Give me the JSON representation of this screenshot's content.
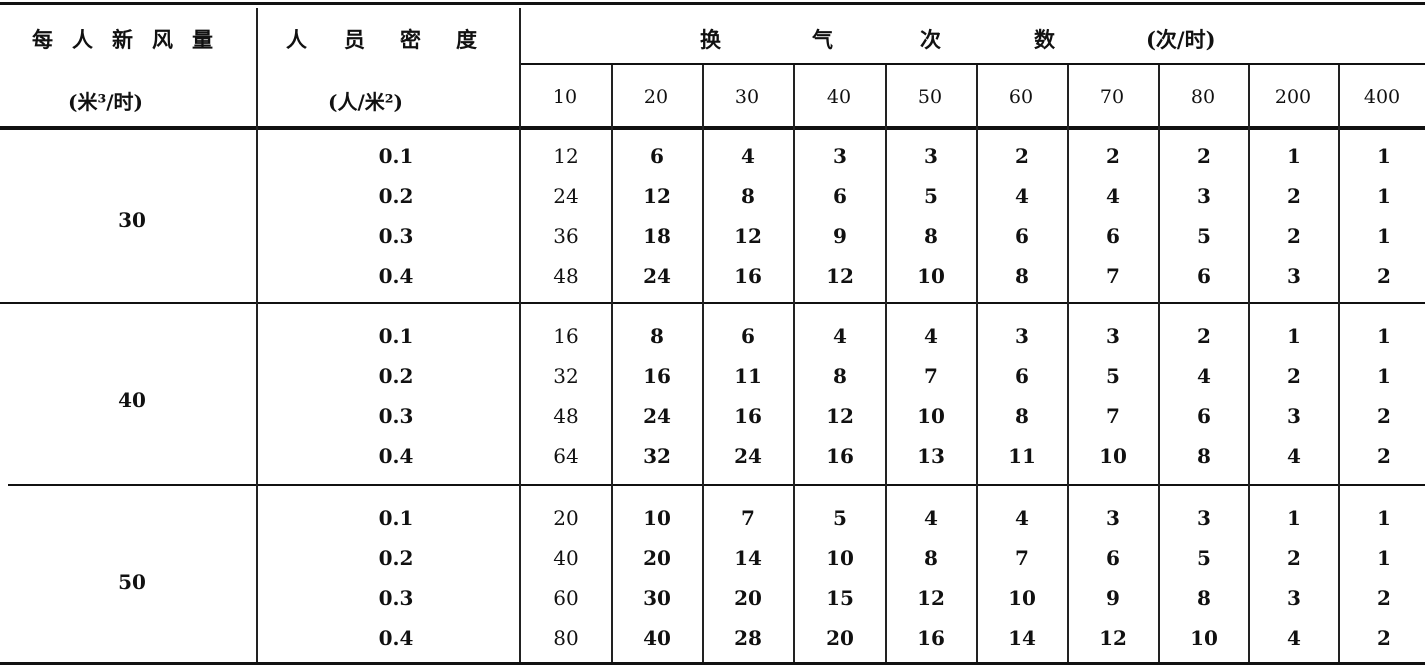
{
  "header": {
    "col1_title_chars": [
      "每",
      "人",
      "新",
      "风",
      "量"
    ],
    "col1_unit": "(米³/时)",
    "col2_title_chars": [
      "人",
      "员",
      "密",
      "度"
    ],
    "col2_unit": "(人/米²)",
    "group_title_chars": [
      "换",
      "气",
      "次",
      "数"
    ],
    "group_unit": "(次/时)",
    "rates": [
      "10",
      "20",
      "30",
      "40",
      "50",
      "60",
      "70",
      "80",
      "200",
      "400"
    ]
  },
  "groups": [
    {
      "fresh_air": "30",
      "rows": [
        {
          "density": "0.1",
          "values": [
            "12",
            "6",
            "4",
            "3",
            "3",
            "2",
            "2",
            "2",
            "1",
            "1"
          ]
        },
        {
          "density": "0.2",
          "values": [
            "24",
            "12",
            "8",
            "6",
            "5",
            "4",
            "4",
            "3",
            "2",
            "1"
          ]
        },
        {
          "density": "0.3",
          "values": [
            "36",
            "18",
            "12",
            "9",
            "8",
            "6",
            "6",
            "5",
            "2",
            "1"
          ]
        },
        {
          "density": "0.4",
          "values": [
            "48",
            "24",
            "16",
            "12",
            "10",
            "8",
            "7",
            "6",
            "3",
            "2"
          ]
        }
      ]
    },
    {
      "fresh_air": "40",
      "rows": [
        {
          "density": "0.1",
          "values": [
            "16",
            "8",
            "6",
            "4",
            "4",
            "3",
            "3",
            "2",
            "1",
            "1"
          ]
        },
        {
          "density": "0.2",
          "values": [
            "32",
            "16",
            "11",
            "8",
            "7",
            "6",
            "5",
            "4",
            "2",
            "1"
          ]
        },
        {
          "density": "0.3",
          "values": [
            "48",
            "24",
            "16",
            "12",
            "10",
            "8",
            "7",
            "6",
            "3",
            "2"
          ]
        },
        {
          "density": "0.4",
          "values": [
            "64",
            "32",
            "24",
            "16",
            "13",
            "11",
            "10",
            "8",
            "4",
            "2"
          ]
        }
      ]
    },
    {
      "fresh_air": "50",
      "rows": [
        {
          "density": "0.1",
          "values": [
            "20",
            "10",
            "7",
            "5",
            "4",
            "4",
            "3",
            "3",
            "1",
            "1"
          ]
        },
        {
          "density": "0.2",
          "values": [
            "40",
            "20",
            "14",
            "10",
            "8",
            "7",
            "6",
            "5",
            "2",
            "1"
          ]
        },
        {
          "density": "0.3",
          "values": [
            "60",
            "30",
            "20",
            "15",
            "12",
            "10",
            "9",
            "8",
            "3",
            "2"
          ]
        },
        {
          "density": "0.4",
          "values": [
            "80",
            "40",
            "28",
            "20",
            "16",
            "14",
            "12",
            "10",
            "4",
            "2"
          ]
        }
      ]
    }
  ]
}
